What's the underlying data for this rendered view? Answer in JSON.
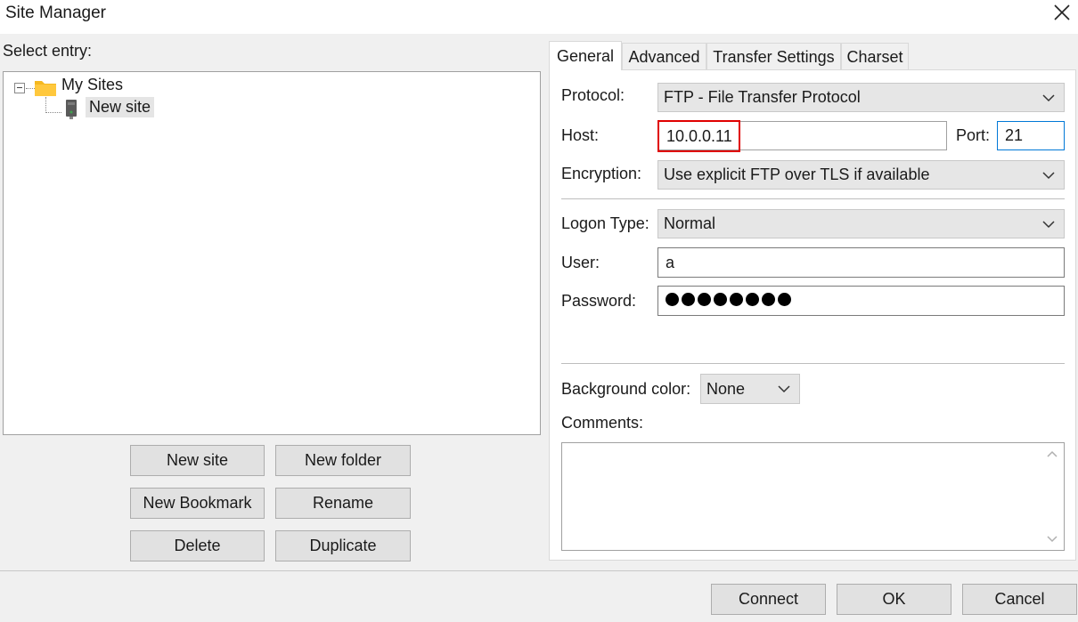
{
  "window": {
    "title": "Site Manager"
  },
  "left": {
    "select_label": "Select entry:",
    "tree": {
      "root_label": "My Sites",
      "child_label": "New site"
    },
    "buttons": {
      "new_site": "New site",
      "new_folder": "New folder",
      "new_bookmark": "New Bookmark",
      "rename": "Rename",
      "delete": "Delete",
      "duplicate": "Duplicate"
    }
  },
  "tabs": [
    "General",
    "Advanced",
    "Transfer Settings",
    "Charset"
  ],
  "general": {
    "protocol_label": "Protocol:",
    "protocol_value": "FTP - File Transfer Protocol",
    "host_label": "Host:",
    "host_value": "10.0.0.11",
    "port_label": "Port:",
    "port_value": "21",
    "encryption_label": "Encryption:",
    "encryption_value": "Use explicit FTP over TLS if available",
    "logon_type_label": "Logon Type:",
    "logon_type_value": "Normal",
    "user_label": "User:",
    "user_value": "a",
    "password_label": "Password:",
    "password_mask_count": 8,
    "bg_color_label": "Background color:",
    "bg_color_value": "None",
    "comments_label": "Comments:"
  },
  "footer": {
    "connect": "Connect",
    "ok": "OK",
    "cancel": "Cancel"
  },
  "colors": {
    "highlight_box": "#e00000",
    "port_focus_border": "#0078d7",
    "folder": "#f5b820"
  }
}
